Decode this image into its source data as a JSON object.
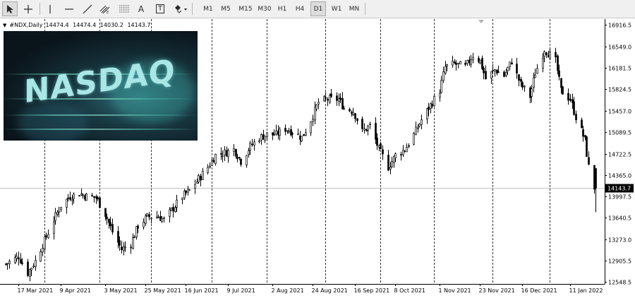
{
  "toolbar": {
    "tools": [
      {
        "name": "cursor-arrow-icon",
        "active": true
      },
      {
        "name": "crosshair-icon"
      },
      {
        "name": "vertical-line-icon"
      },
      {
        "name": "horizontal-line-icon"
      },
      {
        "name": "trendline-icon"
      },
      {
        "name": "channel-icon"
      },
      {
        "name": "fibonacci-icon"
      },
      {
        "name": "text-icon",
        "label": "A"
      },
      {
        "name": "text-label-icon",
        "label": "T"
      },
      {
        "name": "shapes-dropdown-icon"
      }
    ],
    "timeframes": [
      "M1",
      "M5",
      "M15",
      "M30",
      "H1",
      "H4",
      "D1",
      "W1",
      "MN"
    ],
    "active_timeframe": "D1"
  },
  "symbol": {
    "name": "#NDX,Daily",
    "open": "14474.4",
    "high": "14474.4",
    "low": "14030.2",
    "close": "14143.7"
  },
  "banner": {
    "logo_text": "NASDAQ"
  },
  "price_label": "14143.7",
  "colors": {
    "background": "#ffffff",
    "candle": "#000000",
    "grid": "#000000",
    "price_line": "#c0c0c0",
    "price_label_bg": "#000000",
    "price_label_text": "#ffffff"
  },
  "chart_data": {
    "type": "candlestick",
    "symbol": "#NDX",
    "timeframe": "Daily",
    "y_ticks": [
      "16916.5",
      "16549.0",
      "16181.5",
      "15824.5",
      "15457.0",
      "15089.5",
      "14722.5",
      "14365.0",
      "13997.5",
      "13640.5",
      "13273.0",
      "12905.5",
      "12548.5"
    ],
    "ylim": [
      12548.5,
      16916.5
    ],
    "x_ticks": [
      "17 Mar 2021",
      "9 Apr 2021",
      "3 May 2021",
      "25 May 2021",
      "16 Jun 2021",
      "9 Jul 2021",
      "2 Aug 2021",
      "24 Aug 2021",
      "16 Sep 2021",
      "8 Oct 2021",
      "1 Nov 2021",
      "23 Nov 2021",
      "16 Dec 2021",
      "11 Jan 2022"
    ],
    "last_price": 14143.7,
    "close_path": [
      [
        "2021-03-10",
        12850
      ],
      [
        "2021-03-17",
        12980
      ],
      [
        "2021-03-22",
        12700
      ],
      [
        "2021-03-26",
        12900
      ],
      [
        "2021-03-31",
        13250
      ],
      [
        "2021-04-05",
        13600
      ],
      [
        "2021-04-09",
        13850
      ],
      [
        "2021-04-14",
        14000
      ],
      [
        "2021-04-19",
        14050
      ],
      [
        "2021-04-23",
        14000
      ],
      [
        "2021-04-28",
        13980
      ],
      [
        "2021-05-03",
        13700
      ],
      [
        "2021-05-07",
        13400
      ],
      [
        "2021-05-12",
        13100
      ],
      [
        "2021-05-17",
        13200
      ],
      [
        "2021-05-21",
        13500
      ],
      [
        "2021-05-26",
        13650
      ],
      [
        "2021-06-01",
        13660
      ],
      [
        "2021-06-04",
        13600
      ],
      [
        "2021-06-09",
        13800
      ],
      [
        "2021-06-14",
        14000
      ],
      [
        "2021-06-18",
        14100
      ],
      [
        "2021-06-23",
        14300
      ],
      [
        "2021-06-28",
        14500
      ],
      [
        "2021-07-02",
        14700
      ],
      [
        "2021-07-08",
        14750
      ],
      [
        "2021-07-12",
        14800
      ],
      [
        "2021-07-16",
        14600
      ],
      [
        "2021-07-21",
        14850
      ],
      [
        "2021-07-26",
        15000
      ],
      [
        "2021-07-30",
        15050
      ],
      [
        "2021-08-04",
        15050
      ],
      [
        "2021-08-09",
        15150
      ],
      [
        "2021-08-13",
        15100
      ],
      [
        "2021-08-18",
        15000
      ],
      [
        "2021-08-23",
        15300
      ],
      [
        "2021-08-27",
        15600
      ],
      [
        "2021-09-01",
        15650
      ],
      [
        "2021-09-07",
        15650
      ],
      [
        "2021-09-10",
        15500
      ],
      [
        "2021-09-15",
        15450
      ],
      [
        "2021-09-20",
        15100
      ],
      [
        "2021-09-24",
        15200
      ],
      [
        "2021-09-29",
        14800
      ],
      [
        "2021-10-04",
        14500
      ],
      [
        "2021-10-08",
        14700
      ],
      [
        "2021-10-13",
        14800
      ],
      [
        "2021-10-18",
        15050
      ],
      [
        "2021-10-22",
        15300
      ],
      [
        "2021-10-27",
        15550
      ],
      [
        "2021-11-01",
        15800
      ],
      [
        "2021-11-04",
        16200
      ],
      [
        "2021-11-09",
        16250
      ],
      [
        "2021-11-15",
        16200
      ],
      [
        "2021-11-19",
        16400
      ],
      [
        "2021-11-23",
        16300
      ],
      [
        "2021-11-26",
        16000
      ],
      [
        "2021-12-01",
        16150
      ],
      [
        "2021-12-06",
        16050
      ],
      [
        "2021-12-10",
        16300
      ],
      [
        "2021-12-15",
        15900
      ],
      [
        "2021-12-20",
        15700
      ],
      [
        "2021-12-23",
        16100
      ],
      [
        "2021-12-28",
        16500
      ],
      [
        "2022-01-03",
        16300
      ],
      [
        "2022-01-06",
        15800
      ],
      [
        "2022-01-11",
        15650
      ],
      [
        "2022-01-14",
        15350
      ],
      [
        "2022-01-19",
        14950
      ],
      [
        "2022-01-21",
        14500
      ],
      [
        "2022-01-24",
        14150
      ]
    ]
  }
}
